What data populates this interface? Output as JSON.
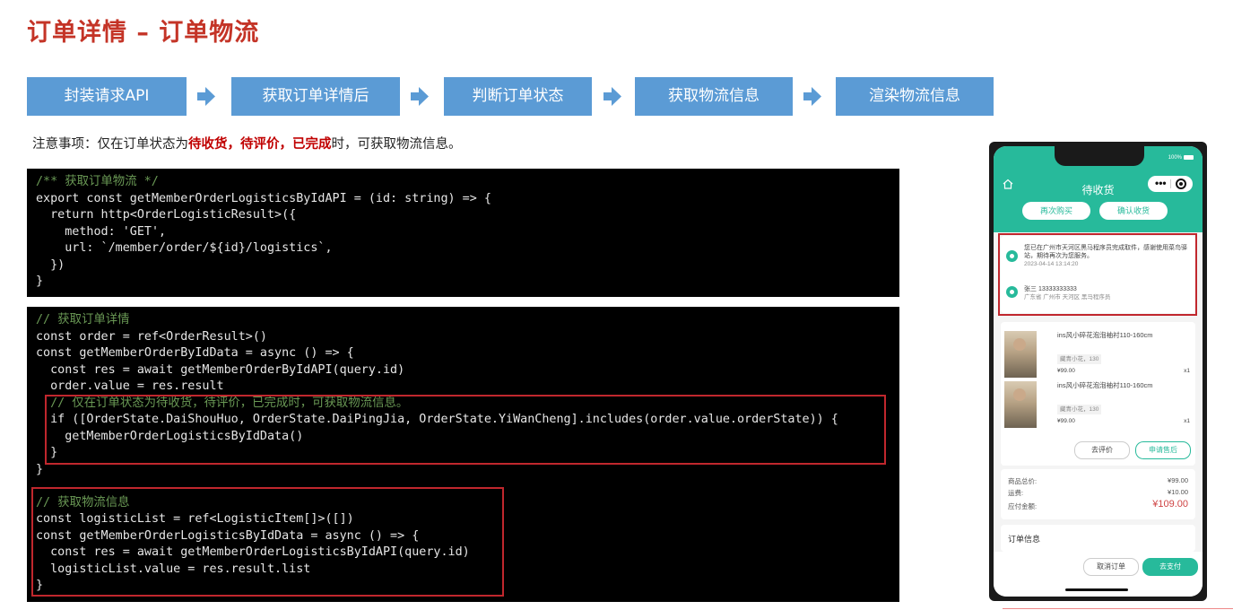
{
  "page": {
    "title": "订单详情 – 订单物流"
  },
  "flow": {
    "steps": [
      "封装请求API",
      "获取订单详情后",
      "判断订单状态",
      "获取物流信息",
      "渲染物流信息"
    ],
    "arrow_color": "#5b9bd5"
  },
  "note": {
    "prefix": "注意事项：仅在订单状态为",
    "highlight": "待收货，待评价，已完成",
    "suffix": "时，可获取物流信息。",
    "highlight_color": "#c00000"
  },
  "code_block_1": {
    "lines": [
      "/** 获取订单物流 */",
      "export const getMemberOrderLogisticsByIdAPI = (id: string) => {",
      "  return http<OrderLogisticResult>({",
      "    method: 'GET',",
      "    url: `/member/order/${id}/logistics`,",
      "  })",
      "}"
    ]
  },
  "code_block_2": {
    "lines": [
      "// 获取订单详情",
      "const order = ref<OrderResult>()",
      "const getMemberOrderByIdData = async () => {",
      "  const res = await getMemberOrderByIdAPI(query.id)",
      "  order.value = res.result",
      "  // 仅在订单状态为待收货，待评价，已完成时，可获取物流信息。",
      "  if ([OrderState.DaiShouHuo, OrderState.DaiPingJia, OrderState.YiWanCheng].includes(order.value.orderState)) {",
      "    getMemberOrderLogisticsByIdData()",
      "  }",
      "}",
      "",
      "// 获取物流信息",
      "const logisticList = ref<LogisticItem[]>([])",
      "const getMemberOrderLogisticsByIdData = async () => {",
      "  const res = await getMemberOrderLogisticsByIdAPI(query.id)",
      "  logisticList.value = res.result.list",
      "}"
    ]
  },
  "phone": {
    "battery": "100%",
    "status_title": "待收货",
    "buttons": {
      "rebuy": "再次购买",
      "confirm": "确认收货"
    },
    "logistics": {
      "text": "您已在广州市天河区黑马程序员完成取件，感谢使用菜鸟驿站，期待再次为您服务。",
      "time": "2023-04-14 13:14:20"
    },
    "address": {
      "contact": "张三 13333333333",
      "detail": "广东省 广州市 天河区 黑马程序员"
    },
    "products": [
      {
        "name": "ins风小碎花泡泡袖衬110-160cm",
        "spec": "藏青小花，130",
        "price": "¥99.00",
        "qty": "x1"
      },
      {
        "name": "ins风小碎花泡泡袖衬110-160cm",
        "spec": "藏青小花，130",
        "price": "¥99.00",
        "qty": "x1"
      }
    ],
    "item_actions": {
      "review": "去评价",
      "after_sale": "申请售后"
    },
    "summary": {
      "goods_label": "商品总价:",
      "goods_value": "¥99.00",
      "freight_label": "运费:",
      "freight_value": "¥10.00",
      "pay_label": "应付金额:",
      "pay_value": "¥109.00"
    },
    "order_info_title": "订单信息",
    "footer": {
      "cancel": "取消订单",
      "pay": "去支付"
    },
    "accent_color": "#27ba9b",
    "price_color": "#cf4444"
  }
}
